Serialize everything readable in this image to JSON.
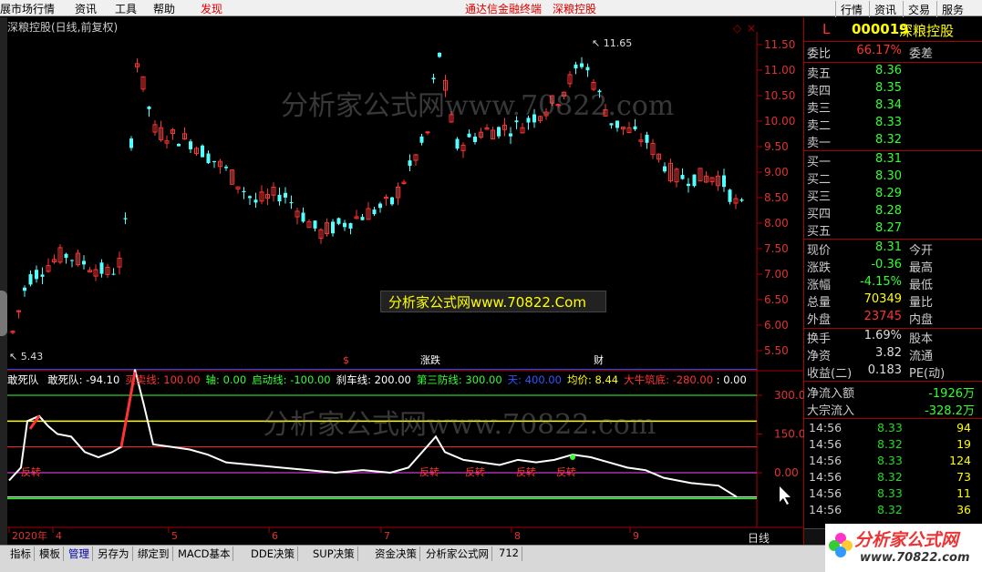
{
  "menu": {
    "items": [
      "展市场行情",
      "资讯",
      "工具",
      "帮助",
      "发现"
    ],
    "center_links": [
      "通达信金融终端",
      "深粮控股"
    ],
    "right_buttons": [
      "行情",
      "资讯",
      "交易",
      "服务"
    ]
  },
  "chart": {
    "title": "深粮控股(日线,前复权)",
    "price_axis": [
      "11.50",
      "11.00",
      "10.50",
      "10.00",
      "9.50",
      "9.00",
      "8.50",
      "8.00",
      "7.50",
      "7.00",
      "6.50",
      "6.00",
      "5.50"
    ],
    "high_label": "11.65",
    "low_label": "5.43",
    "markers": [
      "$",
      "涨跌",
      "财"
    ],
    "watermark_top": "分析家公式网www.70822.com",
    "banner": "分析家公式网www.70822.Com"
  },
  "indicator": {
    "name": "敢死队",
    "items": [
      {
        "label": "敢死队",
        "value": "-94.10",
        "color": "#ffffff"
      },
      {
        "label": "买卖线",
        "value": "100.00",
        "color": "#ff3333"
      },
      {
        "label": "轴",
        "value": "0.00",
        "color": "#33ff33"
      },
      {
        "label": "启动线",
        "value": "-100.00",
        "color": "#33ff33"
      },
      {
        "label": "刹车线",
        "value": "200.00",
        "color": "#ffffff"
      },
      {
        "label": "第三防线",
        "value": "300.00",
        "color": "#33ff33"
      },
      {
        "label": "天",
        "value": "400.00",
        "color": "#3355ff"
      },
      {
        "label": "均价",
        "value": "8.44",
        "color": "#ffff00"
      },
      {
        "label": "大牛筑底",
        "value": "-280.00",
        "color": "#ff3333"
      }
    ],
    "tail": ": 0.00",
    "axis": [
      "300.0",
      "150.0",
      "0.00"
    ],
    "signals": [
      "反转",
      "反转",
      "反转",
      "反转",
      "反转"
    ],
    "watermark": "分析家公式网www.70822.com"
  },
  "dates": [
    "2020年",
    "4",
    "5",
    "6",
    "7",
    "8",
    "9"
  ],
  "right_panel": {
    "flag": "L",
    "code": "000019",
    "name": "深粮控股",
    "webi_label": "委比",
    "webi_value": "66.17%",
    "weicha_label": "委差",
    "asks": [
      {
        "label": "卖五",
        "price": "8.36"
      },
      {
        "label": "卖四",
        "price": "8.35"
      },
      {
        "label": "卖三",
        "price": "8.34"
      },
      {
        "label": "卖二",
        "price": "8.33"
      },
      {
        "label": "卖一",
        "price": "8.32"
      }
    ],
    "bids": [
      {
        "label": "买一",
        "price": "8.31"
      },
      {
        "label": "买二",
        "price": "8.30"
      },
      {
        "label": "买三",
        "price": "8.29"
      },
      {
        "label": "买四",
        "price": "8.28"
      },
      {
        "label": "买五",
        "price": "8.27"
      }
    ],
    "stats": [
      {
        "label": "现价",
        "value": "8.31",
        "color": "#33ff33",
        "label2": "今开"
      },
      {
        "label": "涨跌",
        "value": "-0.36",
        "color": "#33ff33",
        "label2": "最高"
      },
      {
        "label": "涨幅",
        "value": "-4.15%",
        "color": "#33ff33",
        "label2": "最低"
      },
      {
        "label": "总量",
        "value": "70349",
        "color": "#ffff00",
        "label2": "量比"
      },
      {
        "label": "外盘",
        "value": "23745",
        "color": "#ff3333",
        "label2": "内盘"
      }
    ],
    "stats2": [
      {
        "label": "换手",
        "value": "1.69%",
        "color": "#dddddd",
        "label2": "股本"
      },
      {
        "label": "净资",
        "value": "3.82",
        "color": "#dddddd",
        "label2": "流通"
      },
      {
        "label": "收益(二)",
        "value": "0.183",
        "color": "#dddddd",
        "label2": "PE(动)"
      }
    ],
    "flows": [
      {
        "label": "净流入额",
        "value": "-1926万"
      },
      {
        "label": "大宗流入",
        "value": "-328.2万"
      }
    ],
    "ticks": [
      {
        "time": "14:56",
        "price": "8.33",
        "vol": "94"
      },
      {
        "time": "14:56",
        "price": "8.32",
        "vol": "19"
      },
      {
        "time": "14:56",
        "price": "8.33",
        "vol": "124"
      },
      {
        "time": "14:56",
        "price": "8.32",
        "vol": "73"
      },
      {
        "time": "14:56",
        "price": "8.33",
        "vol": "11"
      },
      {
        "time": "14:56",
        "price": "8.32",
        "vol": "36"
      }
    ],
    "period": "日线"
  },
  "tabs": [
    "指标",
    "模板",
    "管理",
    "另存为",
    "绑定到",
    "MACD基本",
    "DDE决策",
    "SUP决策",
    "资金决策",
    "分析家公式网",
    "712"
  ],
  "logo": {
    "line1": "分析家公式网",
    "line2": "www.70822.com"
  }
}
